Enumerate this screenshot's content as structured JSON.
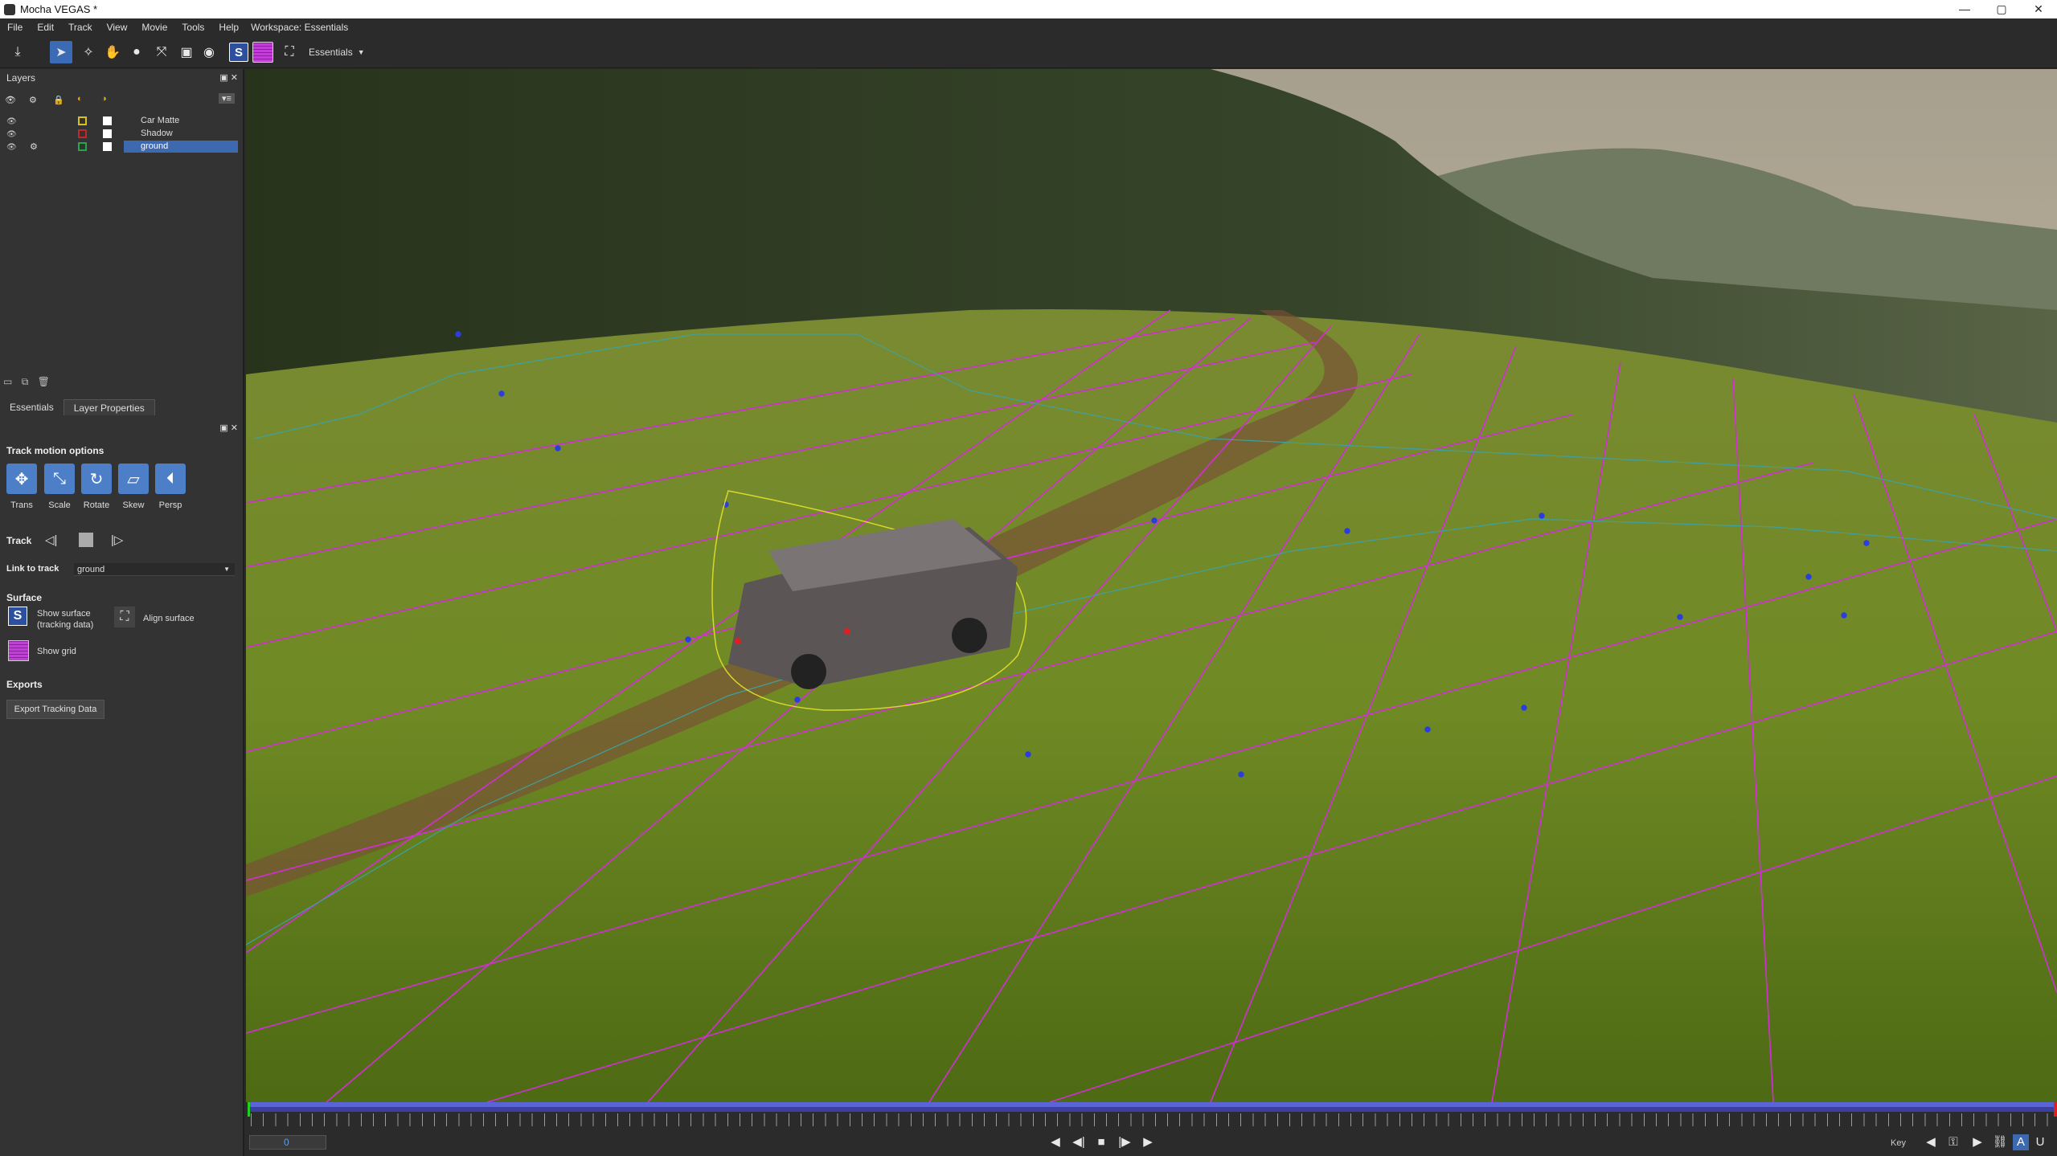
{
  "window": {
    "title": "Mocha VEGAS *",
    "controls": [
      "minimize",
      "maximize",
      "close"
    ]
  },
  "menu": {
    "items": [
      "File",
      "Edit",
      "Track",
      "View",
      "Movie",
      "Tools",
      "Help"
    ],
    "workspace_label": "Workspace: Essentials"
  },
  "toolbar": {
    "workspace_select": "Essentials",
    "tools": [
      "import-icon",
      "pointer-icon",
      "add-point-icon",
      "hand-icon",
      "zoom-icon",
      "transform-icon",
      "select-icon",
      "mag-icon",
      "show-surface-icon",
      "show-grid-icon",
      "align-icon"
    ]
  },
  "layers_panel": {
    "title": "Layers",
    "layers": [
      {
        "name": "Car Matte",
        "color": "#d6c21a",
        "selected": false
      },
      {
        "name": "Shadow",
        "color": "#c2272d",
        "selected": false
      },
      {
        "name": "ground",
        "color": "#20a84a",
        "selected": true
      }
    ]
  },
  "properties": {
    "tabs": [
      "Essentials",
      "Layer Properties"
    ],
    "track_motion_title": "Track motion options",
    "motion_buttons": [
      "Trans",
      "Scale",
      "Rotate",
      "Skew",
      "Persp"
    ],
    "track_label": "Track",
    "link_to_track_label": "Link to track",
    "link_to_track_value": "ground",
    "surface_title": "Surface",
    "show_surface_label_1": "Show surface",
    "show_surface_label_2": "(tracking data)",
    "align_surface_label": "Align surface",
    "show_grid_label": "Show grid",
    "exports_title": "Exports",
    "export_button": "Export Tracking Data"
  },
  "timeline": {
    "current_frame": "0",
    "key_label": "Key"
  },
  "colors": {
    "accent": "#3d69b0",
    "grid": "#d22ed6",
    "spline": "#2a3de0",
    "timeline_bar": "#5864d8"
  }
}
